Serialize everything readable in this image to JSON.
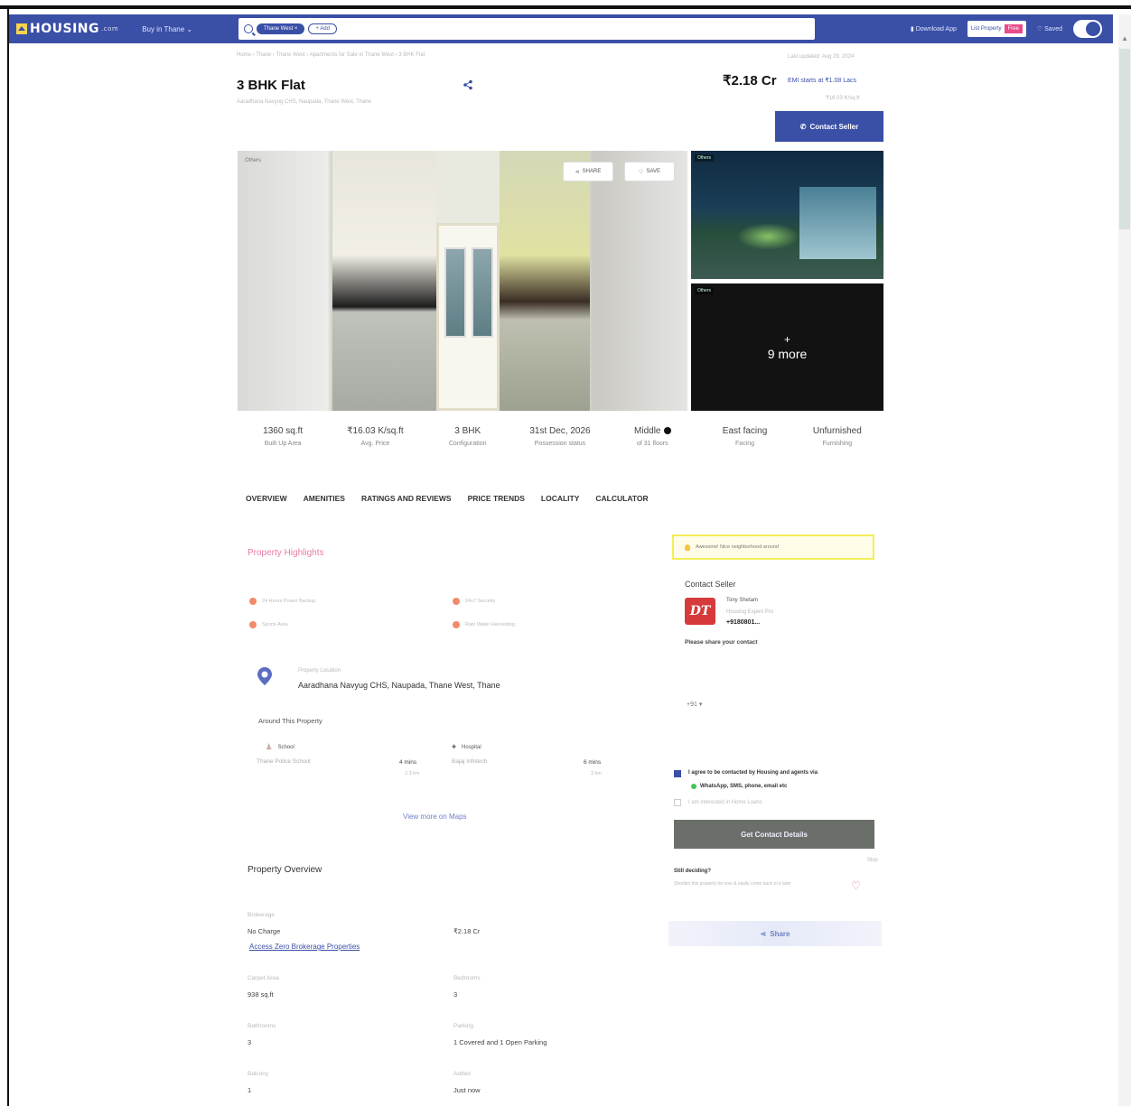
{
  "header": {
    "logo_text": "HOUSING",
    "logo_suffix": ".com",
    "city_menu": "Buy in Thane",
    "search_chip": "Thane West",
    "search_add": "+ Add",
    "download_app": "Download App",
    "list_property": "List Property",
    "free_badge": "Free",
    "saved": "Saved"
  },
  "property": {
    "breadcrumb": "Home › Thane › Thane West › Apartments for Sale in Thane West › 3 BHK Flat",
    "last_updated": "Last updated: Aug 29, 2024",
    "title": "3 BHK Flat",
    "address": "Aaradhana Navyug CHS, Naupada, Thane West, Thane",
    "price": "₹2.18 Cr",
    "emi": "EMI starts at ₹1.08 Lacs",
    "price_per_sqft": "₹16.03 K/sq.ft",
    "contact_button": "Contact Seller"
  },
  "gallery": {
    "main_tag": "Others",
    "share_label": "SHARE",
    "save_label": "SAVE",
    "thumb1_tag": "Others",
    "thumb2_tag": "Others",
    "plus": "+",
    "more": "9 more"
  },
  "stats": [
    {
      "value": "1360 sq.ft",
      "label": "Built Up Area"
    },
    {
      "value": "₹16.03 K/sq.ft",
      "label": "Avg. Price"
    },
    {
      "value": "3 BHK",
      "label": "Configuration"
    },
    {
      "value": "31st Dec, 2026",
      "label": "Possession status"
    },
    {
      "value": "Middle",
      "label": "of 31 floors"
    },
    {
      "value": "East facing",
      "label": "Facing"
    },
    {
      "value": "Unfurnished",
      "label": "Furnishing"
    }
  ],
  "tabs": [
    "OVERVIEW",
    "AMENITIES",
    "RATINGS AND REVIEWS",
    "PRICE TRENDS",
    "LOCALITY",
    "CALCULATOR"
  ],
  "highlights": {
    "title": "Property Highlights",
    "items": [
      "24 Hours Power Backup",
      "24x7 Security",
      "Sports Area",
      "Rain Water Harvesting"
    ]
  },
  "location": {
    "sub": "Property Location",
    "address": "Aaradhana Navyug CHS, Naupada, Thane West, Thane",
    "around": "Around This Property",
    "pois": [
      {
        "type": "School",
        "name": "Thane Police School",
        "time": "4 mins",
        "dist": "2.3 km"
      },
      {
        "type": "Hospital",
        "name": "Bajaj Infotech",
        "time": "6 mins",
        "dist": "3 km"
      }
    ],
    "view_maps": "View more on Maps"
  },
  "overview": {
    "title": "Property Overview",
    "brokerage_label": "Brokerage",
    "brokerage_value": "No Charge",
    "price_value": "₹2.18 Cr",
    "zero_brokerage_link": "Access Zero Brokerage Properties",
    "carpet_label": "Carpet Area",
    "carpet_value": "938 sq.ft",
    "bedrooms_label": "Bedrooms",
    "bedrooms_value": "3",
    "bathrooms_label": "Bathrooms",
    "bathrooms_value": "3",
    "parking_label": "Parking",
    "parking_value": "1 Covered and 1 Open Parking",
    "balcony_label": "Balcony",
    "balcony_value": "1",
    "added_label": "Added",
    "added_value": "Just now"
  },
  "sidebar": {
    "awesome": "Awesome! Nice neighborhood around",
    "contact_title": "Contact Seller",
    "avatar_initials": "DT",
    "seller_name": "Tony Shetam",
    "seller_sub": "Housing Expert Pro",
    "seller_phone": "+9180801...",
    "share_contact": "Please share your contact",
    "country_code": "+91 ▾",
    "agree_text": "I agree to be contacted by Housing and agents via",
    "whatsapp_text": "WhatsApp, SMS, phone, email etc",
    "home_loan": "I am interested in Home Loans",
    "get_button": "Get Contact Details",
    "skip": "Skip",
    "still_deciding": "Still deciding?",
    "shortlist_text": "Shortlist this property for now & easily come back to it later",
    "share": "Share"
  }
}
